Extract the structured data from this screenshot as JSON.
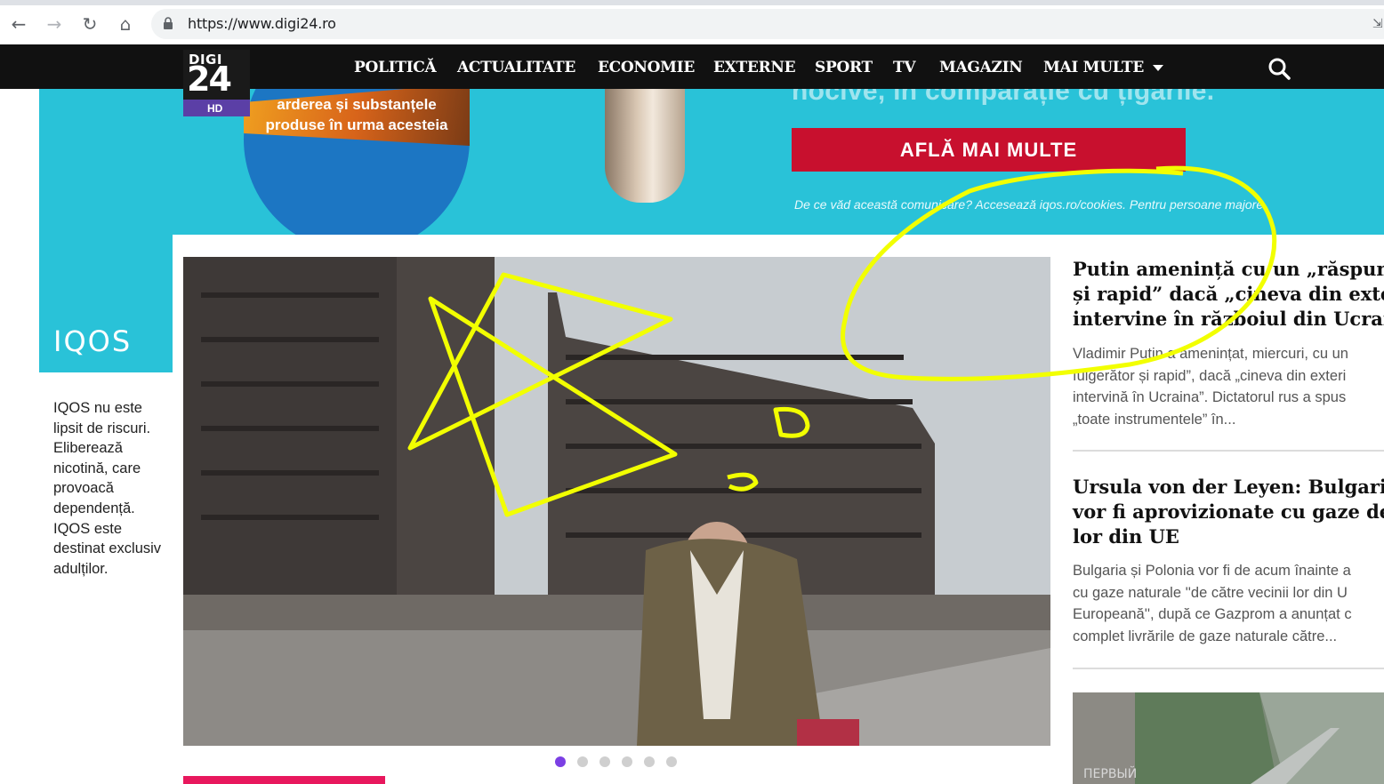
{
  "browser": {
    "url": "https://www.digi24.ro"
  },
  "site": {
    "logo_top": "DIGI",
    "logo_num": "24",
    "logo_hd": "HD",
    "nav": [
      {
        "label": "POLITICĂ"
      },
      {
        "label": "ACTUALITATE"
      },
      {
        "label": "ECONOMIE"
      },
      {
        "label": "EXTERNE"
      },
      {
        "label": "SPORT"
      },
      {
        "label": "TV"
      },
      {
        "label": "MAGAZIN"
      },
      {
        "label": "MAI MULTE"
      }
    ]
  },
  "ad": {
    "circle_line1": "arderea și substanțele",
    "circle_line2": "produse în urma acesteia",
    "cut_headline": "nocive, în comparație cu țigările.",
    "cta_label": "AFLĂ MAI MULTE",
    "disclaimer": "De ce văd această comunicare? Accesează iqos.ro/cookies. Pentru persoane majore",
    "brand": "IQOS",
    "side_text": "IQOS nu este lipsit de riscuri. Eliberează nicotină, care provoacă dependență. IQOS este destinat exclusiv adulților.",
    "colors": {
      "banner": "#29c2d8",
      "cta": "#c8102e",
      "circle": "#1c76c3"
    }
  },
  "articles": [
    {
      "title": "Putin amenință cu un „răspuns f\nși rapid” dacă „cineva din exteri\nintervine în războiul din Ucraina",
      "summary": "Vladimir Putin a amenințat, miercuri, cu un\nfulgerător și rapid”, dacă „cineva din exteri\nintervină în Ucraina”. Dictatorul rus a spus\n„toate instrumentele” în..."
    },
    {
      "title": "Ursula von der Leyen: Bulgaria ș\nvor fi aprovizionate cu gaze de c\nlor din UE",
      "summary": "Bulgaria și Polonia vor fi de acum înainte a\ncu gaze naturale ''de către vecinii lor din U\nEuropeană'', după ce Gazprom a anunțat c\ncomplet livrările de gaze naturale către..."
    }
  ],
  "thumb_watermark": "ПЕРВЫЙ",
  "carousel": {
    "total": 6,
    "active": 1
  },
  "colors": {
    "header": "#111111",
    "accent": "#e8175d",
    "dot_active": "#7b3fe4",
    "annotation": "#f2ff00"
  }
}
